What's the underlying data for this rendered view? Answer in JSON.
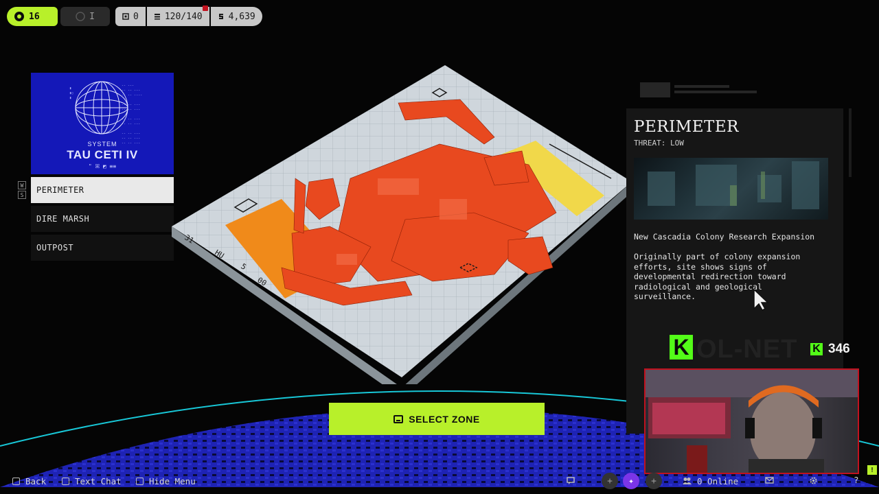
{
  "hud": {
    "level": "16",
    "rank": "I",
    "stat_a": "0",
    "capacity": "120/140",
    "credits": "4,639"
  },
  "system": {
    "label": "SYSTEM",
    "name": "TAU CETI IV",
    "glyphs": "\" ꕤ ◩ ≡≡",
    "hotkey_up": "W",
    "hotkey_down": "S"
  },
  "zones": [
    {
      "label": "PERIMETER",
      "active": true
    },
    {
      "label": "DIRE MARSH",
      "active": false
    },
    {
      "label": "OUTPOST",
      "active": false
    }
  ],
  "map": {
    "edge_labels": [
      "31",
      "HU",
      "5",
      "00"
    ]
  },
  "select_zone_label": "SELECT ZONE",
  "details": {
    "title": "PERIMETER",
    "threat": "THREAT: LOW",
    "subtitle": "New Cascadia Colony Research Expansion",
    "description": "Originally part of colony expansion efforts, site shows signs of developmental redirection toward radiological and geological surveillance."
  },
  "kick": {
    "logo": "K",
    "viewers": "346",
    "watermark": "OL-NET"
  },
  "bottom_bar": {
    "back": "Back",
    "text_chat": "Text Chat",
    "hide_menu": "Hide Menu",
    "online": "0 Online",
    "help": "?"
  },
  "colors": {
    "accent": "#b8f02a",
    "system_card": "#1418b8",
    "zone_orange": "#e8491f",
    "kick_green": "#53fc18"
  },
  "icons": [
    "level-icon",
    "capacity-icon",
    "credits-icon",
    "chat-icon",
    "settings-icon",
    "mail-icon",
    "users-icon"
  ]
}
